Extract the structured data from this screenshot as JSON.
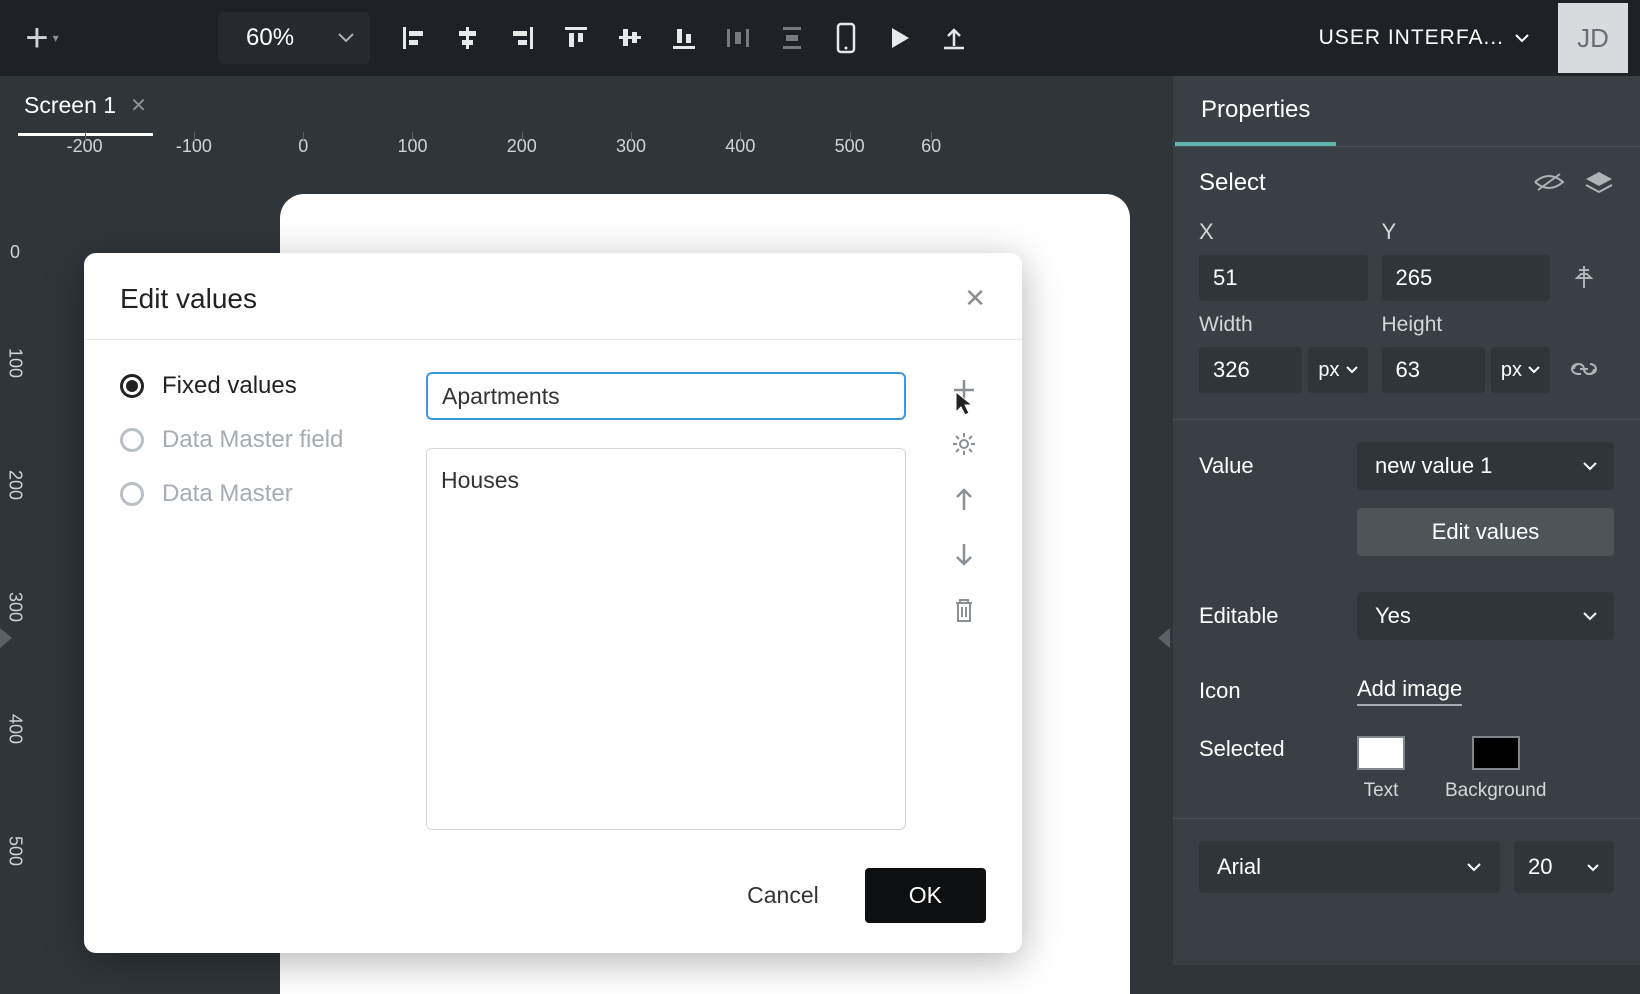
{
  "toolbar": {
    "zoom": "60%",
    "project_name": "USER INTERFA...",
    "avatar_initials": "JD"
  },
  "tabs": [
    {
      "label": "Screen 1"
    }
  ],
  "ruler_h": [
    "-200",
    "-100",
    "0",
    "100",
    "200",
    "300",
    "400",
    "500",
    "60"
  ],
  "ruler_v": [
    "0",
    "100",
    "200",
    "300",
    "400",
    "500"
  ],
  "properties": {
    "title": "Properties",
    "element": "Select",
    "x_label": "X",
    "y_label": "Y",
    "x": "51",
    "y": "265",
    "width_label": "Width",
    "height_label": "Height",
    "width": "326",
    "height": "63",
    "unit": "px",
    "value_label": "Value",
    "value": "new value 1",
    "edit_values_btn": "Edit values",
    "editable_label": "Editable",
    "editable": "Yes",
    "icon_label": "Icon",
    "add_image": "Add image",
    "selected_label": "Selected",
    "text_swatch": "Text",
    "bg_swatch": "Background",
    "font": "Arial",
    "font_size": "20"
  },
  "modal": {
    "title": "Edit values",
    "radios": {
      "fixed": "Fixed values",
      "dm_field": "Data Master field",
      "dm": "Data Master"
    },
    "input_value": "Apartments",
    "list": [
      "Houses"
    ],
    "cancel": "Cancel",
    "ok": "OK"
  }
}
